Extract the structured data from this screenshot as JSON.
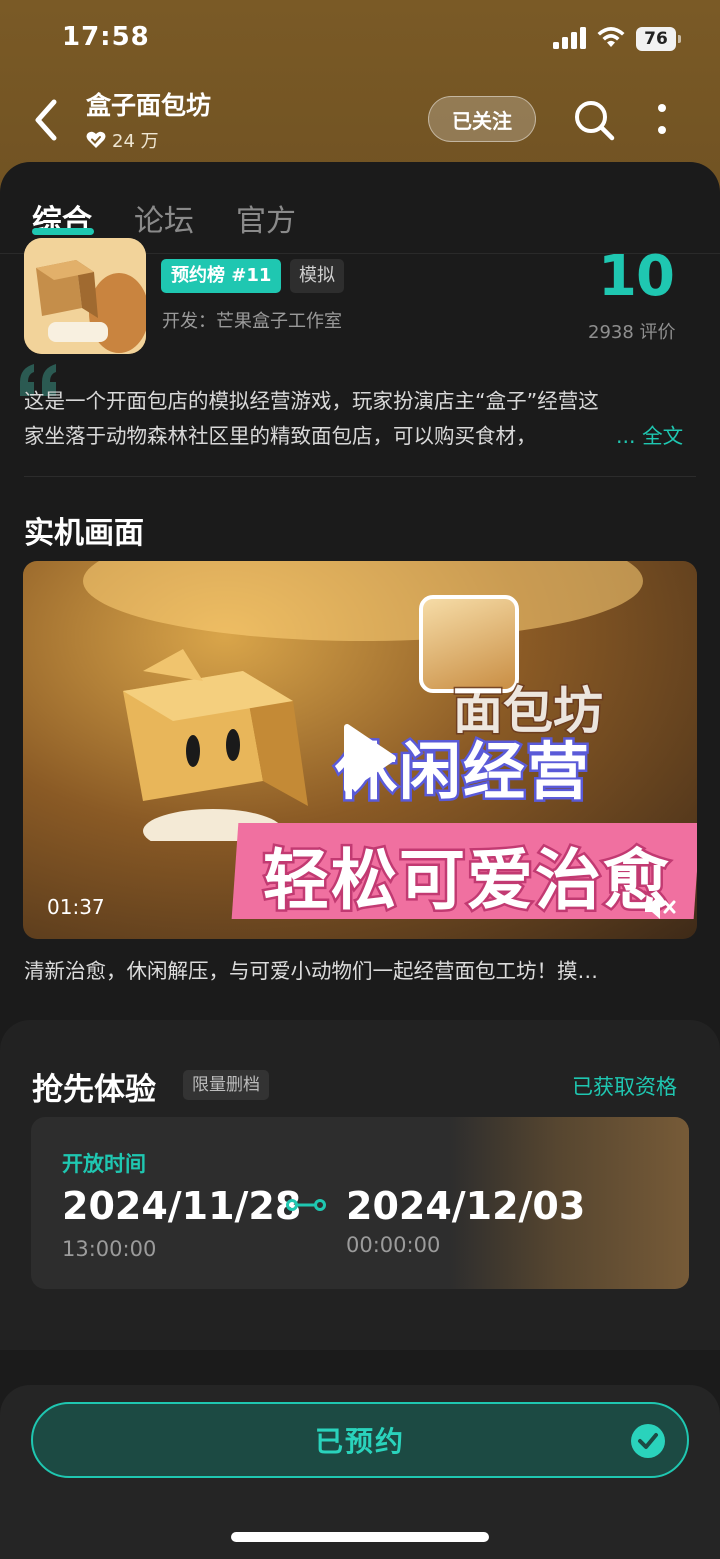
{
  "status_bar": {
    "time": "17:58",
    "battery": "76"
  },
  "header": {
    "title": "盒子面包坊",
    "followers": "24 万",
    "follow_label": "已关注"
  },
  "tabs": [
    {
      "label": "综合"
    },
    {
      "label": "论坛"
    },
    {
      "label": "官方"
    }
  ],
  "game": {
    "rank": "预约榜 #11",
    "genre": "模拟",
    "developer": "开发：芒果盒子工作室",
    "score": "10",
    "reviews": "2938 评价",
    "description_line1": "这是一个开面包店的模拟经营游戏，玩家扮演店主“盒子”经营这",
    "description_line2": "家坐落于动物森林社区里的精致面包店，可以购买食材，",
    "read_more": "... 全文"
  },
  "screenshots": {
    "title": "实机画面",
    "video_art_text_top": "休闲经营",
    "video_art_text_bottom": "轻松可爱治愈",
    "video_art_logo": "面包坊",
    "duration": "01:37",
    "caption": "清新治愈，休闲解压，与可爱小动物们一起经营面包工坊！摸…"
  },
  "early_access": {
    "title": "抢先体验",
    "tag": "限量删档",
    "status": "已获取资格",
    "open_label": "开放时间",
    "start_date": "2024/11/28",
    "start_time": "13:00:00",
    "end_date": "2024/12/03",
    "end_time": "00:00:00"
  },
  "bottom": {
    "reserve_label": "已预约"
  },
  "colors": {
    "accent": "#1fc7b1",
    "header_bg": "#7a5a26",
    "background": "#1b1b1b"
  }
}
